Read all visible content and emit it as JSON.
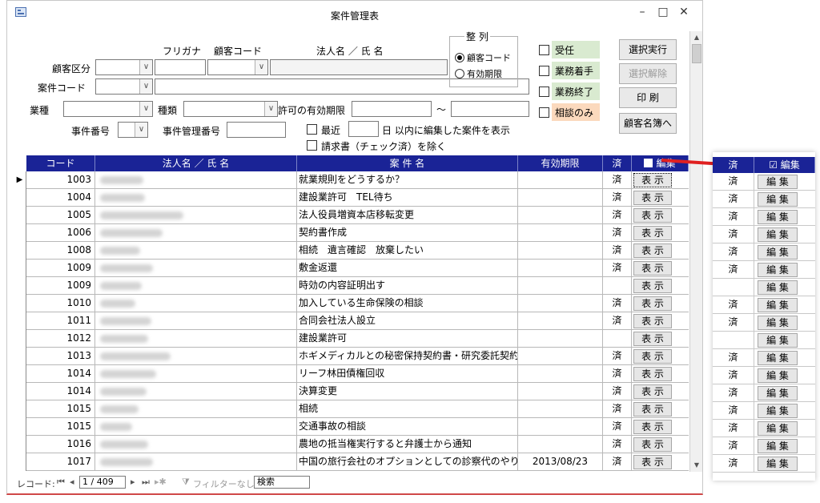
{
  "window": {
    "title": "案件管理表",
    "minimize": "–",
    "maximize": "□",
    "close": "✕"
  },
  "form": {
    "furigana_label": "フリガナ",
    "customer_code_label": "顧客コード",
    "corp_name_label": "法人名 ／ 氏 名",
    "customer_type_label": "顧客区分",
    "case_code_label": "案件コード",
    "industry_label": "業種",
    "kind_label": "種類",
    "expiry_label": "許可の有効期限",
    "tilde": "～",
    "case_number_label": "事件番号",
    "case_mgmt_number_label": "事件管理番号",
    "recent_label": "最近",
    "recent_suffix": "日 以内に編集した案件を表示",
    "invoice_label": "請求書（チェック済）を除く",
    "sort": {
      "title": "整 列",
      "opt1": "顧客コード",
      "opt2": "有効期限"
    },
    "status": {
      "accepted": "受任",
      "started": "業務着手",
      "finished": "業務終了",
      "consult": "相談のみ"
    },
    "buttons": {
      "run": "選択実行",
      "clear": "選択解除",
      "print": "印 刷",
      "roster": "顧客名簿へ"
    }
  },
  "grid": {
    "headers": {
      "code": "コード",
      "name": "法人名 ／ 氏 名",
      "case": "案 件 名",
      "expiry": "有効期限",
      "done": "済",
      "edit": "編集"
    },
    "show_label": "表 示",
    "rows": [
      {
        "code": "1003",
        "case": "就業規則をどうするか？",
        "expiry": "",
        "done": "済"
      },
      {
        "code": "1004",
        "case": "建設業許可　TEL待ち",
        "expiry": "",
        "done": "済"
      },
      {
        "code": "1005",
        "case": "法人役員増資本店移転変更",
        "expiry": "",
        "done": "済"
      },
      {
        "code": "1006",
        "case": "契約書作成",
        "expiry": "",
        "done": "済"
      },
      {
        "code": "1008",
        "case": "相続　遺言確認　放棄したい",
        "expiry": "",
        "done": "済"
      },
      {
        "code": "1009",
        "case": "敷金返還",
        "expiry": "",
        "done": "済"
      },
      {
        "code": "1009",
        "case": "時効の内容証明出す",
        "expiry": "",
        "done": ""
      },
      {
        "code": "1010",
        "case": "加入している生命保険の相談",
        "expiry": "",
        "done": "済"
      },
      {
        "code": "1011",
        "case": "合同会社法人設立",
        "expiry": "",
        "done": "済"
      },
      {
        "code": "1012",
        "case": "建設業許可",
        "expiry": "",
        "done": ""
      },
      {
        "code": "1013",
        "case": "ホギメディカルとの秘密保持契約書・研究委託契約書",
        "expiry": "",
        "done": "済"
      },
      {
        "code": "1014",
        "case": "リーフ林田債権回収",
        "expiry": "",
        "done": "済"
      },
      {
        "code": "1014",
        "case": "決算変更",
        "expiry": "",
        "done": "済"
      },
      {
        "code": "1015",
        "case": "相続",
        "expiry": "",
        "done": "済"
      },
      {
        "code": "1015",
        "case": "交通事故の相談",
        "expiry": "",
        "done": "済"
      },
      {
        "code": "1016",
        "case": "農地の抵当権実行すると弁護士から通知",
        "expiry": "",
        "done": "済"
      },
      {
        "code": "1017",
        "case": "中国の旅行会社のオプションとしての診察代のやりとり",
        "expiry": "2013/08/23",
        "done": "済"
      }
    ]
  },
  "statusbar": {
    "record_label": "レコード:",
    "record_value": "1 / 409",
    "filter_label": "フィルターなし",
    "search_label": "検索"
  },
  "side": {
    "header_done": "済",
    "header_edit": "編集",
    "header_check": "☑",
    "edit_label": "編 集",
    "done_flags": [
      "済",
      "済",
      "済",
      "済",
      "済",
      "済",
      "",
      "済",
      "済",
      "",
      "済",
      "済",
      "済",
      "済",
      "済",
      "済",
      "済"
    ]
  },
  "colors": {
    "header_bg": "#1a2396",
    "arrow": "#e02020",
    "green": "#d9ead0",
    "orange": "#fbd9bd"
  }
}
